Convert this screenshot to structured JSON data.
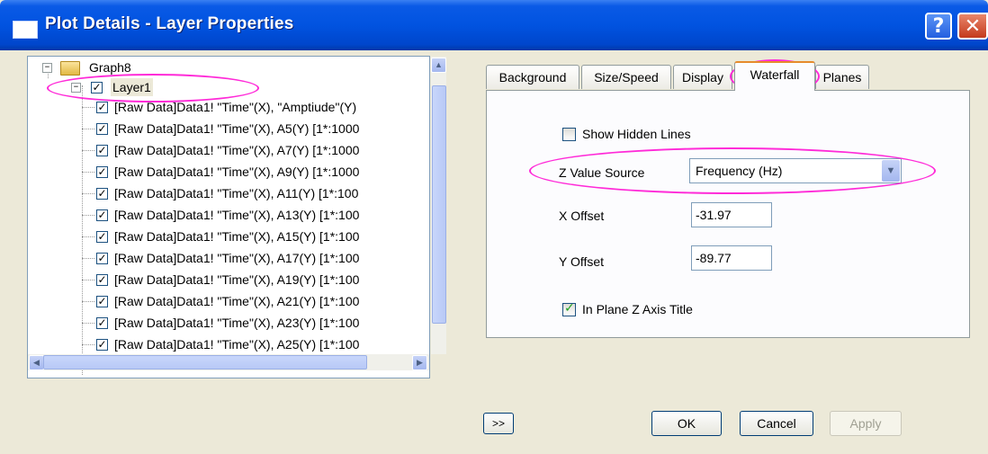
{
  "window": {
    "title": "Plot Details - Layer Properties",
    "help_glyph": "?",
    "close_glyph": "✕"
  },
  "tree": {
    "root": {
      "label": "Graph8",
      "expander": "−"
    },
    "layer": {
      "label": "Layer1",
      "expander": "−",
      "check": "✓"
    },
    "items": [
      {
        "check": "✓",
        "label": "[Raw Data]Data1! \"Time\"(X), \"Amptiude\"(Y)"
      },
      {
        "check": "✓",
        "label": "[Raw Data]Data1! \"Time\"(X), A5(Y) [1*:1000"
      },
      {
        "check": "✓",
        "label": "[Raw Data]Data1! \"Time\"(X), A7(Y) [1*:1000"
      },
      {
        "check": "✓",
        "label": "[Raw Data]Data1! \"Time\"(X), A9(Y) [1*:1000"
      },
      {
        "check": "✓",
        "label": "[Raw Data]Data1! \"Time\"(X), A11(Y) [1*:100"
      },
      {
        "check": "✓",
        "label": "[Raw Data]Data1! \"Time\"(X), A13(Y) [1*:100"
      },
      {
        "check": "✓",
        "label": "[Raw Data]Data1! \"Time\"(X), A15(Y) [1*:100"
      },
      {
        "check": "✓",
        "label": "[Raw Data]Data1! \"Time\"(X), A17(Y) [1*:100"
      },
      {
        "check": "✓",
        "label": "[Raw Data]Data1! \"Time\"(X), A19(Y) [1*:100"
      },
      {
        "check": "✓",
        "label": "[Raw Data]Data1! \"Time\"(X), A21(Y) [1*:100"
      },
      {
        "check": "✓",
        "label": "[Raw Data]Data1! \"Time\"(X), A23(Y) [1*:100"
      },
      {
        "check": "✓",
        "label": "[Raw Data]Data1! \"Time\"(X), A25(Y) [1*:100"
      }
    ],
    "scroll_up": "▲",
    "scroll_left": "◀",
    "scroll_right": "▶"
  },
  "tabs": [
    {
      "label": "Background"
    },
    {
      "label": "Size/Speed"
    },
    {
      "label": "Display"
    },
    {
      "label": "Waterfall",
      "active": true
    },
    {
      "label": "Planes"
    }
  ],
  "waterfall": {
    "show_hidden_lines": {
      "label": "Show Hidden Lines",
      "checked": false
    },
    "z_value_source": {
      "label": "Z Value Source",
      "value": "Frequency (Hz)",
      "arrow": "▼"
    },
    "x_offset": {
      "label": "X Offset",
      "value": "-31.97"
    },
    "y_offset": {
      "label": "Y Offset",
      "value": "-89.77"
    },
    "in_plane_z_axis_title": {
      "label": "In Plane Z Axis Title",
      "checked": true
    }
  },
  "buttons": {
    "more": ">>",
    "ok": "OK",
    "cancel": "Cancel",
    "apply": "Apply"
  },
  "colors": {
    "annotation": "#ff2ad8",
    "titlebar": "#0153e0",
    "dialog_bg": "#ece9d8"
  }
}
